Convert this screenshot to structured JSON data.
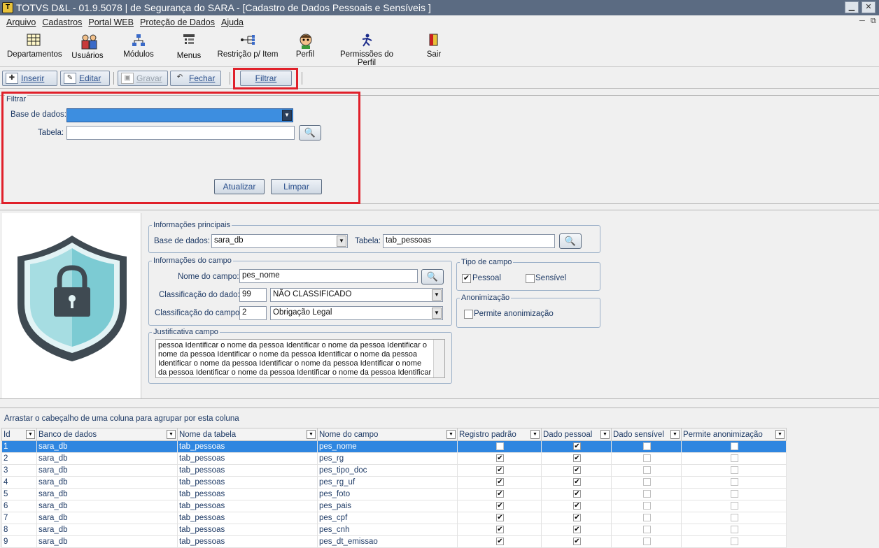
{
  "window": {
    "title": "TOTVS D&L - 01.9.5078 | de Segurança do SARA - [Cadastro de Dados Pessoais e Sensíveis ]",
    "minimize_glyph": "▁",
    "close_glyph": "✕"
  },
  "menu": [
    "Arquivo",
    "Cadastros",
    "Portal WEB",
    "Proteção de Dados",
    "Ajuda"
  ],
  "toolbar": {
    "items": [
      {
        "label": "Departamentos",
        "icon": "grid-icon"
      },
      {
        "label": "Usuários",
        "icon": "users-icon"
      },
      {
        "label": "Módulos",
        "icon": "hierarchy-icon"
      },
      {
        "label": "Menus",
        "icon": "menu-icon"
      },
      {
        "label": "Restrição p/ Item",
        "icon": "network-icon"
      },
      {
        "label": "Perfil",
        "icon": "profile-icon"
      },
      {
        "label": "Permissões do Perfil",
        "icon": "permissions-icon"
      },
      {
        "label": "Sair",
        "icon": "exit-icon"
      }
    ]
  },
  "commands": {
    "inserir": "Inserir",
    "editar": "Editar",
    "gravar": "Gravar",
    "fechar": "Fechar",
    "filtrar": "Filtrar"
  },
  "filter": {
    "title": "Filtrar",
    "base_label": "Base de dados:",
    "base_value": "",
    "table_label": "Tabela:",
    "table_value": "",
    "atualizar": "Atualizar",
    "limpar": "Limpar"
  },
  "info": {
    "main_title": "Informações principais",
    "base_label": "Base de dados:",
    "base_value": "sara_db",
    "table_label": "Tabela:",
    "table_value": "tab_pessoas",
    "field_title": "Informações do campo",
    "field_name_label": "Nome do campo:",
    "field_name_value": "pes_nome",
    "class_data_label": "Classificação do dado:",
    "class_data_code": "99",
    "class_data_value": "NÃO CLASSIFICADO",
    "class_field_label": "Classificação do campo:",
    "class_field_code": "2",
    "class_field_value": "Obrigação Legal",
    "type_title": "Tipo de campo",
    "pessoal": "Pessoal",
    "pessoal_checked": true,
    "sensivel": "Sensível",
    "sensivel_checked": false,
    "anon_title": "Anonimização",
    "anon_label": "Permite anonimização",
    "anon_checked": false,
    "justification_title": "Justificativa campo",
    "justification_text": "pessoa Identificar o nome da pessoa Identificar o nome da pessoa Identificar o nome da pessoa Identificar o nome da pessoa Identificar o nome da pessoa Identificar o nome da pessoa Identificar o nome da pessoa Identificar o nome da pessoa Identificar o nome da pessoa Identificar o nome da pessoa Identificar o nome da pe"
  },
  "grid": {
    "group_hint": "Arrastar o cabeçalho de uma coluna para agrupar por esta coluna",
    "columns": [
      "Id",
      "Banco de dados",
      "Nome da tabela",
      "Nome do campo",
      "Registro padrão",
      "Dado pessoal",
      "Dado sensível",
      "Permite anonimização"
    ],
    "rows": [
      {
        "id": "1",
        "db": "sara_db",
        "table": "tab_pessoas",
        "field": "pes_nome",
        "reg": false,
        "pessoal": true,
        "sensivel": false,
        "anon": false
      },
      {
        "id": "2",
        "db": "sara_db",
        "table": "tab_pessoas",
        "field": "pes_rg",
        "reg": true,
        "pessoal": true,
        "sensivel": false,
        "anon": false
      },
      {
        "id": "3",
        "db": "sara_db",
        "table": "tab_pessoas",
        "field": "pes_tipo_doc",
        "reg": true,
        "pessoal": true,
        "sensivel": false,
        "anon": false
      },
      {
        "id": "4",
        "db": "sara_db",
        "table": "tab_pessoas",
        "field": "pes_rg_uf",
        "reg": true,
        "pessoal": true,
        "sensivel": false,
        "anon": false
      },
      {
        "id": "5",
        "db": "sara_db",
        "table": "tab_pessoas",
        "field": "pes_foto",
        "reg": true,
        "pessoal": true,
        "sensivel": false,
        "anon": false
      },
      {
        "id": "6",
        "db": "sara_db",
        "table": "tab_pessoas",
        "field": "pes_pais",
        "reg": true,
        "pessoal": true,
        "sensivel": false,
        "anon": false
      },
      {
        "id": "7",
        "db": "sara_db",
        "table": "tab_pessoas",
        "field": "pes_cpf",
        "reg": true,
        "pessoal": true,
        "sensivel": false,
        "anon": false
      },
      {
        "id": "8",
        "db": "sara_db",
        "table": "tab_pessoas",
        "field": "pes_cnh",
        "reg": true,
        "pessoal": true,
        "sensivel": false,
        "anon": false
      },
      {
        "id": "9",
        "db": "sara_db",
        "table": "tab_pessoas",
        "field": "pes_dt_emissao",
        "reg": true,
        "pessoal": true,
        "sensivel": false,
        "anon": false
      }
    ],
    "selected_row": 0
  },
  "colors": {
    "title_bar": "#5b6b82",
    "highlight_red": "#e0202a",
    "selection_blue": "#2f86e0",
    "shield_dark": "#3f4a52",
    "shield_teal": "#7ccbd3"
  }
}
